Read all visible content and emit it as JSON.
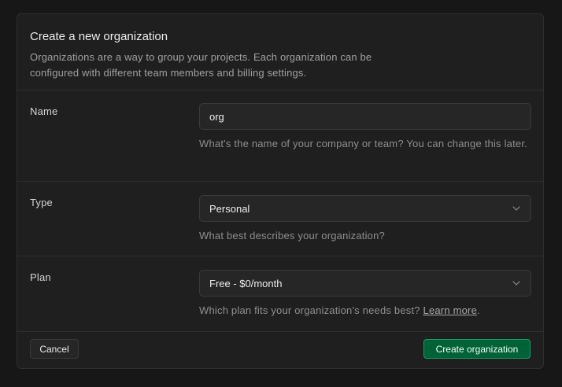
{
  "dialog": {
    "title": "Create a new organization",
    "description": "Organizations are a way to group your projects. Each organization can be configured with different team members and billing settings."
  },
  "fields": {
    "name": {
      "label": "Name",
      "value": "org",
      "help": "What's the name of your company or team? You can change this later."
    },
    "type": {
      "label": "Type",
      "selected": "Personal",
      "help": "What best describes your organization?"
    },
    "plan": {
      "label": "Plan",
      "selected": "Free - $0/month",
      "help_prefix": "Which plan fits your organization's needs best?",
      "help_link": "Learn more",
      "help_suffix": "."
    }
  },
  "footer": {
    "cancel_label": "Cancel",
    "create_label": "Create organization"
  },
  "icons": {
    "select_chevron": "chevron-down-icon"
  },
  "colors": {
    "background": "#171717",
    "panel": "#1f1f1f",
    "border": "#2e2e2e",
    "primary_button": "#006239",
    "primary_button_border": "#1f9d63"
  }
}
